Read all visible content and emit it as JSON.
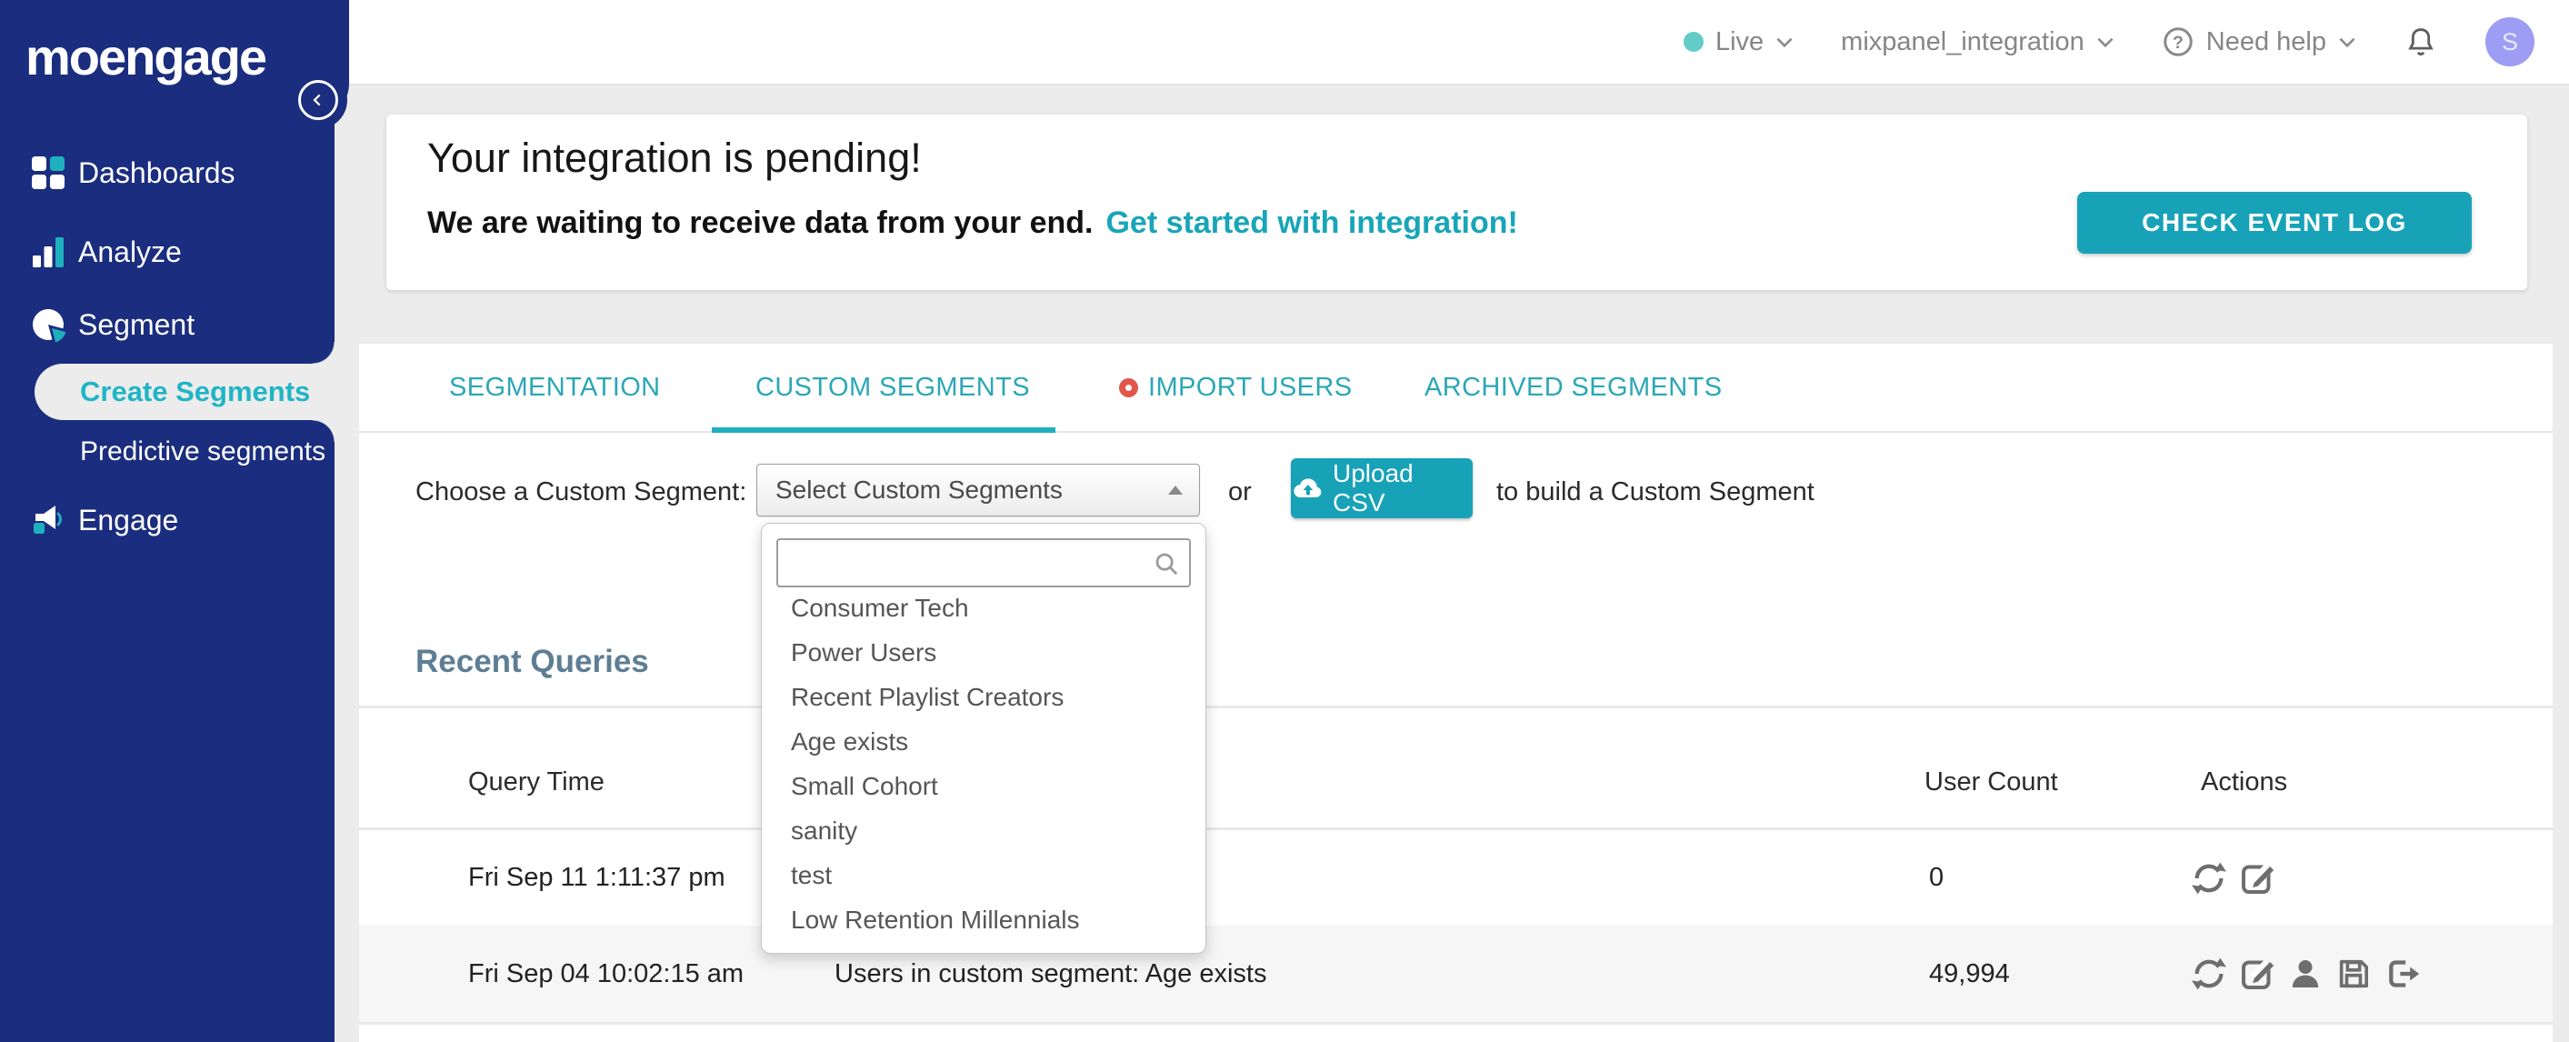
{
  "logo_text": "moengage",
  "topbar": {
    "env_label": "Live",
    "project_label": "mixpanel_integration",
    "help_label": "Need help",
    "avatar_initial": "S"
  },
  "sidebar": {
    "items": [
      {
        "label": "Dashboards",
        "icon": "grid-icon"
      },
      {
        "label": "Analyze",
        "icon": "bar-chart-icon"
      },
      {
        "label": "Segment",
        "icon": "pie-chart-icon"
      },
      {
        "label": "Engage",
        "icon": "megaphone-icon"
      }
    ],
    "segment_children": [
      {
        "label": "Create Segments",
        "active": true
      },
      {
        "label": "Predictive segments",
        "active": false
      }
    ]
  },
  "banner": {
    "title": "Your integration is pending!",
    "message": "We are waiting to receive data from your end.",
    "link_label": "Get started with integration!",
    "button_label": "CHECK EVENT LOG"
  },
  "tabs": [
    {
      "label": "SEGMENTATION",
      "active": false
    },
    {
      "label": "CUSTOM SEGMENTS",
      "active": true
    },
    {
      "label": "IMPORT USERS",
      "active": false,
      "badge": true
    },
    {
      "label": "ARCHIVED SEGMENTS",
      "active": false
    }
  ],
  "segment_picker": {
    "label": "Choose a Custom Segment:",
    "selected_value": "Select Custom Segments",
    "or_text": "or",
    "upload_button_label": "Upload CSV",
    "suffix_text": "to build a Custom Segment",
    "search_placeholder": ""
  },
  "dropdown_items": [
    "Consumer Tech",
    "Power Users",
    "Recent Playlist Creators",
    "Age exists",
    "Small Cohort",
    "sanity",
    "test",
    "Low Retention Millennials"
  ],
  "recent_queries": {
    "title": "Recent Queries",
    "columns": {
      "time": "Query Time",
      "count": "User Count",
      "actions": "Actions"
    },
    "rows": [
      {
        "time": "Fri Sep 11 1:11:37 pm",
        "description": "",
        "count": "0",
        "actions": [
          "refresh",
          "edit"
        ]
      },
      {
        "time": "Fri Sep 04 10:02:15 am",
        "description": "Users in custom segment: Age exists",
        "count": "49,994",
        "actions": [
          "refresh",
          "edit",
          "user",
          "save",
          "export"
        ]
      }
    ]
  },
  "colors": {
    "sidebar_navy": "#1B2D7E",
    "accent_teal": "#17A2B8",
    "tab_teal": "#2BA7B6",
    "live_dot_teal": "#63CCC8",
    "section_title_slate": "#5D7E95",
    "avatar_purple": "#9C9DF3",
    "badge_red": "#E2574C",
    "row_alt_bg": "#F6F6F6",
    "page_bg": "#ECECEC"
  }
}
